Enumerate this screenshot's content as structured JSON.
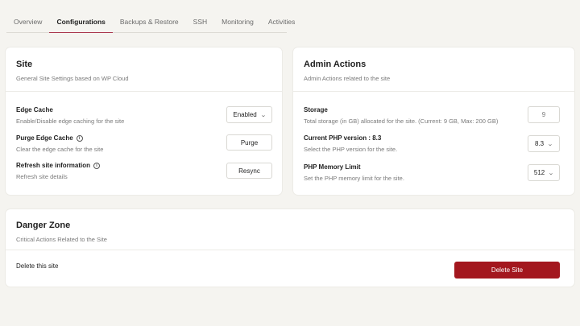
{
  "tabs": [
    "Overview",
    "Configurations",
    "Backups & Restore",
    "SSH",
    "Monitoring",
    "Activities"
  ],
  "active_tab": "Configurations",
  "site": {
    "title": "Site",
    "subtitle": "General Site Settings based on WP Cloud",
    "edge_cache": {
      "label": "Edge Cache",
      "desc": "Enable/Disable edge caching for the site",
      "value": "Enabled"
    },
    "purge": {
      "label": "Purge Edge Cache",
      "desc": "Clear the edge cache for the site",
      "button": "Purge"
    },
    "refresh": {
      "label": "Refresh site information",
      "desc": "Refresh site details",
      "button": "Resync"
    }
  },
  "admin": {
    "title": "Admin Actions",
    "subtitle": "Admin Actions related to the site",
    "storage": {
      "label": "Storage",
      "desc": "Total storage (in GB) allocated for the site. (Current: 9 GB, Max: 200 GB)",
      "value": "9"
    },
    "php": {
      "label": "Current PHP version : 8.3",
      "desc": "Select the PHP version for the site.",
      "value": "8.3"
    },
    "memory": {
      "label": "PHP Memory Limit",
      "desc": "Set the PHP memory limit for the site.",
      "value": "512"
    }
  },
  "danger": {
    "title": "Danger Zone",
    "subtitle": "Critical Actions Related to the Site",
    "delete_label": "Delete this site",
    "delete_button": "Delete Site"
  },
  "colors": {
    "accent": "#a8324a",
    "danger": "#a3171e",
    "background": "#f5f4f0"
  },
  "icons": {
    "info": "info-icon",
    "chevron": "chevron-down-icon"
  }
}
